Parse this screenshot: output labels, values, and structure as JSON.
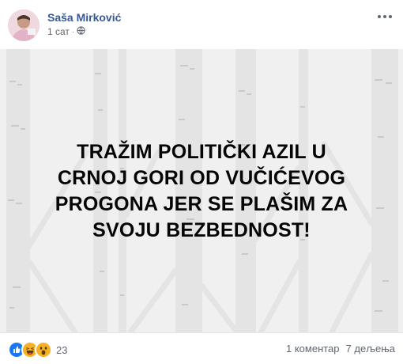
{
  "post": {
    "author": "Saša Mirković",
    "time": "1 сат",
    "time_separator": "·",
    "privacy_icon": "globe-icon",
    "text_lines": [
      "TRAŽIM POLITIČKI AZIL U",
      "CRNOJ GORI OD VUČIĆEVOG",
      "PROGONA JER SE PLAŠIM ZA",
      "SVOJU BEZBEDNOST!"
    ]
  },
  "footer": {
    "reactions": [
      "like-reaction-icon",
      "haha-reaction-icon",
      "wow-reaction-icon"
    ],
    "reaction_count": "23",
    "comments": "1 коментар",
    "shares": "7 дељења"
  },
  "colors": {
    "author": "#385898",
    "meta": "#606770",
    "background": "#f0f0f0",
    "text": "#050505",
    "like": "#1877f2",
    "emoji": "#f7b125"
  }
}
